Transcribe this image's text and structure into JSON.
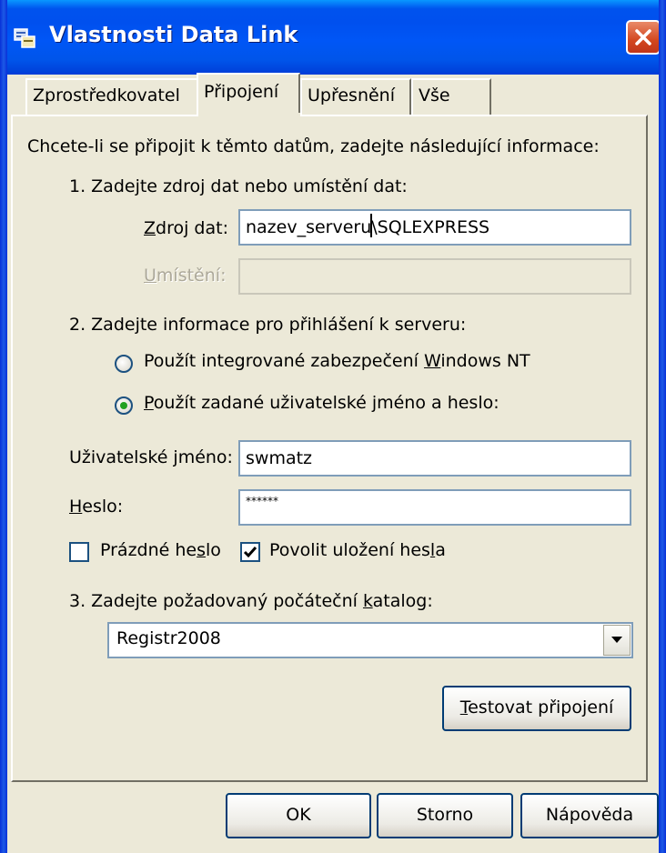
{
  "window": {
    "title": "Vlastnosti Data Link"
  },
  "tabs": [
    {
      "label": "Zprostředkovatel"
    },
    {
      "label": "Připojení"
    },
    {
      "label": "Upřesnění"
    },
    {
      "label": "Vše"
    }
  ],
  "connection": {
    "intro": "Chcete-li se připojit k těmto datům, zadejte následující informace:",
    "step1": "1. Zadejte zdroj dat nebo umístění dat:",
    "datasource_label_u": "Z",
    "datasource_label_rest": "droj dat:",
    "datasource_value_a": "nazev_serveru",
    "datasource_value_b": "\\SQLEXPRESS",
    "location_label_u": "U",
    "location_label_rest": "místění:",
    "location_value": "",
    "step2": "2. Zadejte informace pro přihlášení k serveru:",
    "radio_integrated_a": "Použít integrované zabezpečení ",
    "radio_integrated_u": "W",
    "radio_integrated_b": "indows NT",
    "radio_specific_u": "P",
    "radio_specific_rest": "oužít zadané uživatelské jméno a heslo:",
    "selected_auth": "specific",
    "username_label": "Uživatelské jméno:",
    "username_value": "swmatz",
    "password_label_u": "H",
    "password_label_rest": "eslo:",
    "password_value": "******",
    "blank_password_a": "Prázdné he",
    "blank_password_u": "s",
    "blank_password_b": "lo",
    "blank_password_checked": false,
    "save_password_a": "Povolit uložení hes",
    "save_password_u": "l",
    "save_password_b": "a",
    "save_password_checked": true,
    "step3_a": "3. Zadejte požadovaný počáteční ",
    "step3_u": "k",
    "step3_b": "atalog:",
    "catalog_value": "Registr2008",
    "test_button_u": "T",
    "test_button_rest": "estovat připojení"
  },
  "footer": {
    "ok_label": "OK",
    "cancel_label": "Storno",
    "help_label": "Nápověda"
  },
  "colors": {
    "title_bar": "#0055ea",
    "dialog_bg": "#ece9d8",
    "close_button": "#d3471f",
    "radio_selected": "#21a121"
  }
}
